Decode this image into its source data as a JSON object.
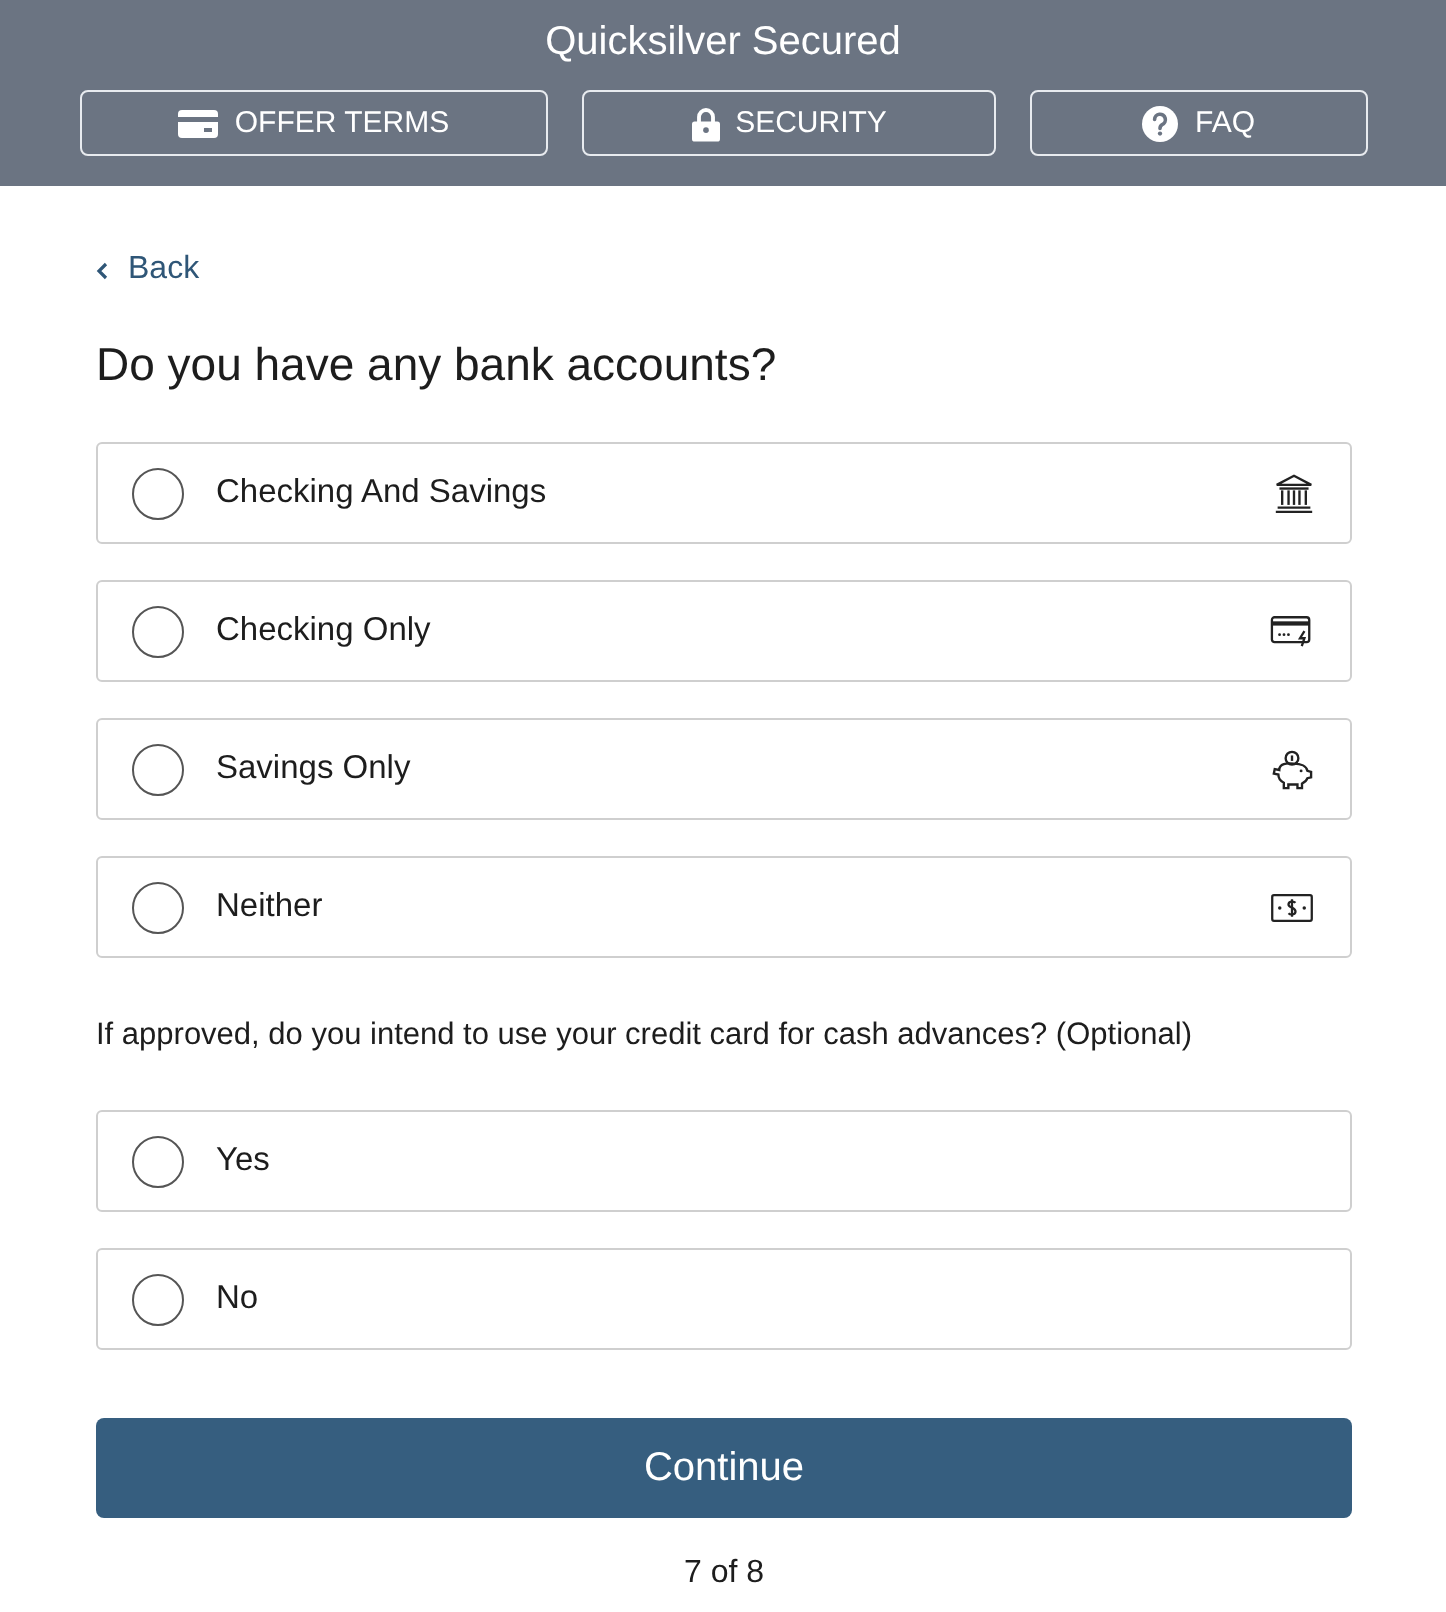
{
  "header": {
    "title": "Quicksilver Secured",
    "buttons": [
      {
        "label": "OFFER TERMS"
      },
      {
        "label": "SECURITY"
      },
      {
        "label": "FAQ"
      }
    ]
  },
  "back_link": {
    "label": "Back"
  },
  "bank_question": {
    "heading": "Do you have any bank accounts?",
    "options": [
      {
        "label": "Checking And Savings",
        "selected": false
      },
      {
        "label": "Checking Only",
        "selected": false
      },
      {
        "label": "Savings Only",
        "selected": false
      },
      {
        "label": "Neither",
        "selected": false
      }
    ]
  },
  "cash_advance_question": {
    "text": "If approved, do you intend to use your credit card for cash advances? (Optional)",
    "options": [
      {
        "label": "Yes",
        "selected": false
      },
      {
        "label": "No",
        "selected": false
      }
    ]
  },
  "continue_button": {
    "label": "Continue"
  },
  "progress": "7 of 8"
}
